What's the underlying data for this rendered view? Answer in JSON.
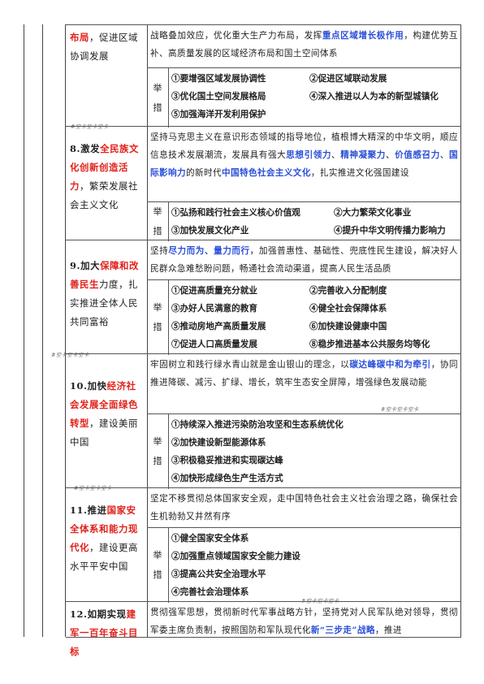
{
  "sections": [
    {
      "id": "s7",
      "topic": {
        "r1": "布局",
        "p1": "，促进区域协调发展"
      },
      "desc": {
        "p1": "战略叠加效应，优化重大生产力布局，发挥",
        "b1": "重点区域增长极作用",
        "p2": "，构建优势互补、高质量发展的区域经济布局和国土空间体系"
      },
      "juji": [
        "举",
        "措"
      ],
      "items": [
        "①要增强区域发展协调性",
        "②促进区域联动发展",
        "③优化国土空间发展格局",
        "④深入推进以人为本的新型城镇化",
        "⑤加强海洋开发利用保护"
      ],
      "watermark": "#空卡空卡空卡"
    },
    {
      "id": "s8",
      "topic": {
        "num": "8.",
        "p0": "激发",
        "r1": "全民族文化创新创造活力",
        "p1": "，繁荣发展社会主义文化"
      },
      "desc": {
        "p1": "坚持马克思主义在意识形态领域的指导地位，植根博大精深的中华文明，顺应信息技术发展潮流，发展具有强大",
        "b1": "思想引领力",
        "s1": "、",
        "b2": "精神凝聚力",
        "s2": "、",
        "b3": "价值感召力",
        "s3": "、",
        "b4": "国际影响力",
        "p2": "的新时代",
        "b5": "中国特色社会主义文化",
        "p3": "，扎实推进文化强国建设"
      },
      "juji": [
        "举",
        "措"
      ],
      "items": [
        "①弘扬和践行社会主义核心价值观",
        "②大力繁荣文化事业",
        "③加快发展文化产业",
        "④提升中华文明传播力影响力"
      ]
    },
    {
      "id": "s9",
      "topic": {
        "num": "9.",
        "p0": "加大",
        "r1": "保障和改善民生",
        "p1": "力度，扎实推进全体人民共同富裕"
      },
      "desc": {
        "p1": "坚持",
        "b1": "尽力而为、量力而行",
        "p2": "，加强普惠性、基础性、兜底性民生建设，解决好人民群众急难愁盼问题，畅通社会流动渠道，提高人民生活品质"
      },
      "juji": [
        "举",
        "措"
      ],
      "items": [
        "①促进高质量充分就业",
        "②完善收入分配制度",
        "③办好人民满意的教育",
        "④健全社会保障体系",
        "⑤推动房地产高质量发展",
        "⑥加快建设健康中国",
        "⑦促进人口高质量发展",
        "⑧稳步推进基本公共服务均等化"
      ],
      "watermark": "#空卡空卡空卡"
    },
    {
      "id": "s10",
      "topic": {
        "num": "10.",
        "p0": "加快",
        "r1": "经济社会发展全面绿色转型",
        "p1": "，建设美丽中国"
      },
      "desc": {
        "p1": "牢固树立和践行绿水青山就是金山银山的理念，以",
        "b1": "碳达峰碳中和为牵引",
        "p2": "，协同推进降碳、减污、扩绿、增长，筑牢生态安全屏障，增强绿色发展动能"
      },
      "juji": [
        "举",
        "措"
      ],
      "items": [
        "①持续深入推进污染防治攻坚和生态系统优化",
        "②加快建设新型能源体系",
        "③积极稳妥推进和实现碳达峰",
        "④加快形成绿色生产生活方式"
      ],
      "watermark": "#空卡空卡空卡",
      "watermark2": "#空卡空卡空卡"
    },
    {
      "id": "s11",
      "topic": {
        "num": "11.",
        "p0": "推进",
        "r1": "国家安全体系和能力现代化",
        "p1": "，建设更高水平平安中国"
      },
      "desc": {
        "p1": "坚定不移贯彻总体国家安全观，走中国特色社会主义社会治理之路，确保社会生机勃勃又井然有序"
      },
      "juji": [
        "举",
        "措"
      ],
      "items": [
        "①健全国家安全体系",
        "②加强重点领域国家安全能力建设",
        "③提高公共安全治理水平",
        "④完善社会治理体系"
      ],
      "watermark": "#空卡空卡空卡"
    },
    {
      "id": "s12",
      "topic": {
        "num": "12.",
        "p0": "如期实现",
        "r1": "建军一百年奋斗目标"
      },
      "desc": {
        "p1": "贯彻强军思想，贯彻新时代军事战略方针，坚持党对人民军队绝对领导，贯彻军委主席负责制，按照国防和军队现代化",
        "b1": "新“三步走”战略",
        "p2": "，推进"
      }
    }
  ]
}
